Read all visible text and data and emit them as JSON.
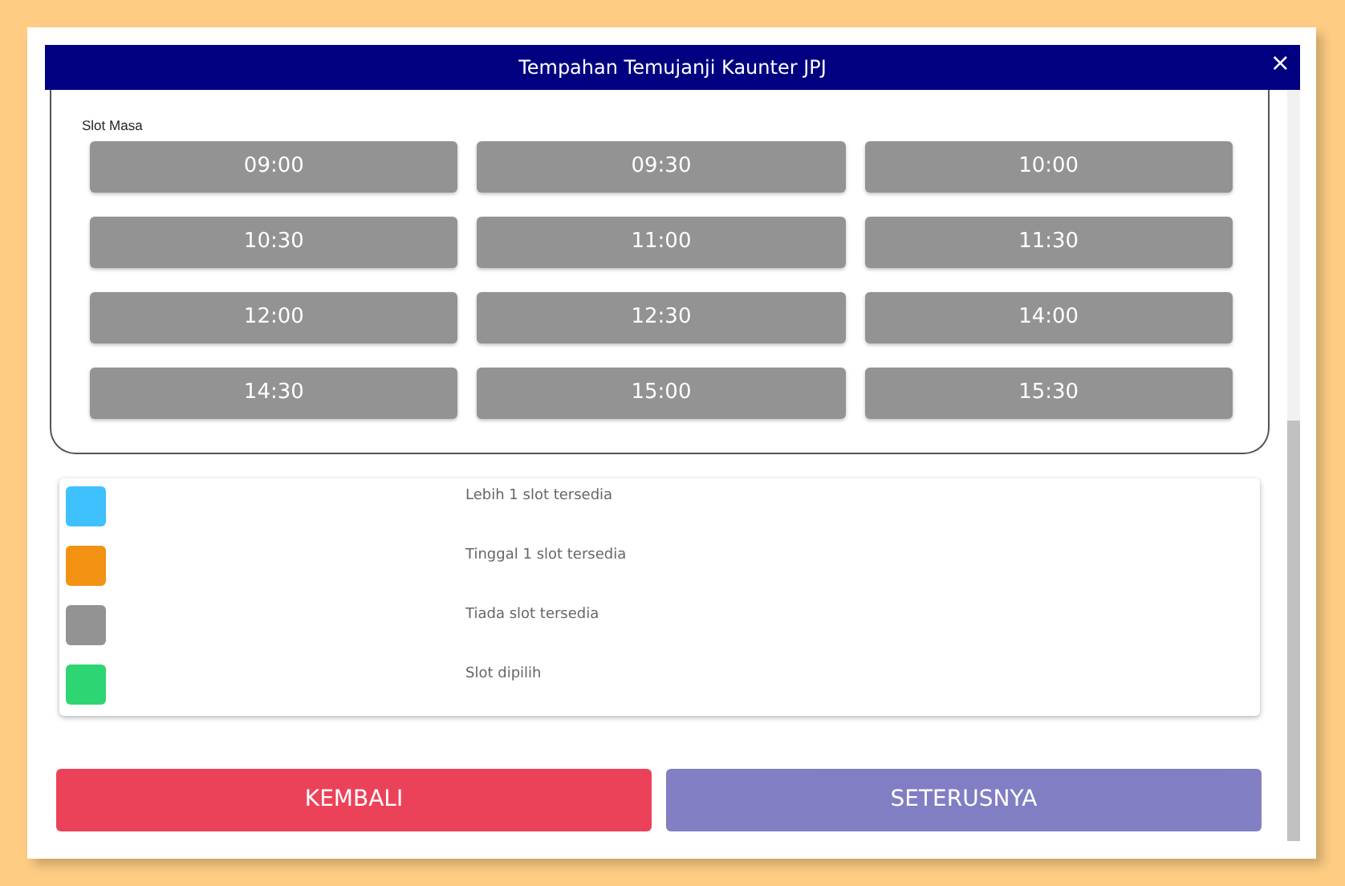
{
  "dialog": {
    "title": "Tempahan Temujanji Kaunter JPJ",
    "close": "×"
  },
  "slots": {
    "label": "Slot Masa",
    "items": [
      {
        "time": "09:00",
        "color": "#939393"
      },
      {
        "time": "09:30",
        "color": "#939393"
      },
      {
        "time": "10:00",
        "color": "#939393"
      },
      {
        "time": "10:30",
        "color": "#939393"
      },
      {
        "time": "11:00",
        "color": "#939393"
      },
      {
        "time": "11:30",
        "color": "#939393"
      },
      {
        "time": "12:00",
        "color": "#939393"
      },
      {
        "time": "12:30",
        "color": "#939393"
      },
      {
        "time": "14:00",
        "color": "#939393"
      },
      {
        "time": "14:30",
        "color": "#939393"
      },
      {
        "time": "15:00",
        "color": "#939393"
      },
      {
        "time": "15:30",
        "color": "#939393"
      }
    ]
  },
  "legend": [
    {
      "label": "Lebih 1 slot tersedia",
      "color": "#3ec1fd"
    },
    {
      "label": "Tinggal 1 slot tersedia",
      "color": "#f39212"
    },
    {
      "label": "Tiada slot tersedia",
      "color": "#939393"
    },
    {
      "label": "Slot dipilih",
      "color": "#2ed573"
    }
  ],
  "buttons": [
    {
      "label": "KEMBALI",
      "kind": "back",
      "disabled": false
    },
    {
      "label": "SETERUSNYA",
      "kind": "next",
      "disabled": true
    }
  ]
}
